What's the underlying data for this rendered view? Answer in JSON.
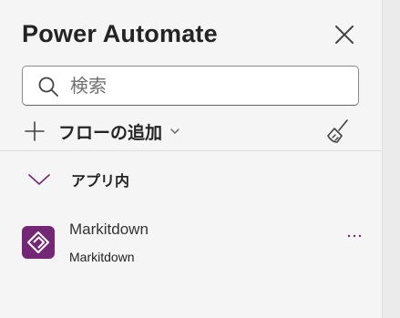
{
  "header": {
    "title": "Power Automate"
  },
  "search": {
    "placeholder": "検索",
    "value": ""
  },
  "toolbar": {
    "add_flow_label": "フローの追加"
  },
  "group": {
    "label": "アプリ内"
  },
  "flows": [
    {
      "name": "Markitdown",
      "subtitle": "Markitdown"
    }
  ],
  "icons": {
    "close": "close-icon",
    "search": "search-icon",
    "add": "plus-icon",
    "dropdown": "chevron-down-icon",
    "clean": "broom-icon",
    "group_toggle": "chevron-down-icon",
    "app": "power-apps-icon",
    "more": "more-icon"
  },
  "colors": {
    "accent": "#742774",
    "background": "#f5f5f5"
  }
}
